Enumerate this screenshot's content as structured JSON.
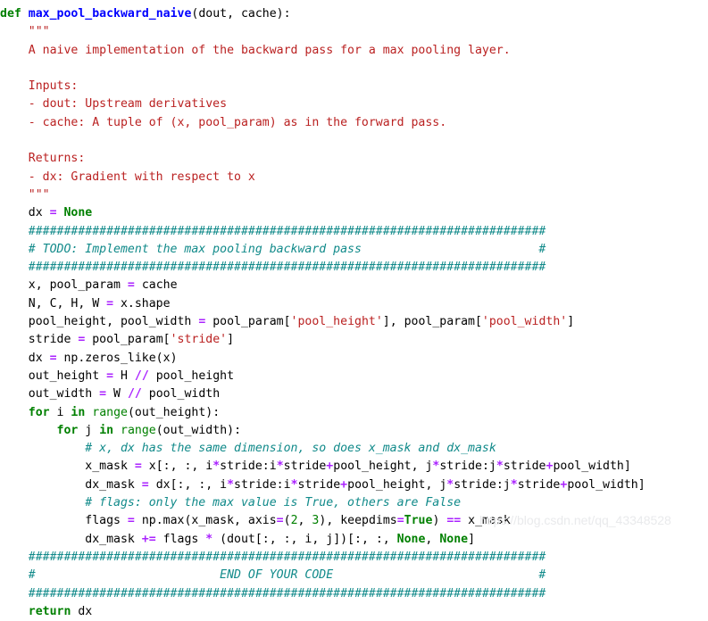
{
  "page": {
    "title": "max_pool_backward_naive",
    "language": "python",
    "background_color": "#ffffff",
    "default_text_color": "#000000"
  },
  "theme": {
    "keyword_color": "#008000",
    "function_name_color": "#0000FF",
    "string_color": "#BA2121",
    "comment_color": "#118A8A",
    "operator_color": "#AA22FF",
    "number_color": "#008000",
    "builtin_color": "#008000",
    "watermark_color": "#e9eaec"
  },
  "watermark": {
    "text": "https://blog.csdn.net/qq_43348528"
  },
  "code": {
    "lines": [
      [
        {
          "t": "def",
          "c": "kw"
        },
        {
          "t": " ",
          "c": "plain"
        },
        {
          "t": "max_pool_backward_naive",
          "c": "fname"
        },
        {
          "t": "(dout, cache):",
          "c": "plain"
        }
      ],
      [
        {
          "t": "    \"\"\"",
          "c": "doc"
        }
      ],
      [
        {
          "t": "    A naive implementation of the backward pass for a max pooling layer.",
          "c": "doc"
        }
      ],
      [
        {
          "t": "",
          "c": "plain"
        }
      ],
      [
        {
          "t": "    Inputs:",
          "c": "doc"
        }
      ],
      [
        {
          "t": "    - dout: Upstream derivatives",
          "c": "doc"
        }
      ],
      [
        {
          "t": "    - cache: A tuple of (x, pool_param) as in the forward pass.",
          "c": "doc"
        }
      ],
      [
        {
          "t": "",
          "c": "plain"
        }
      ],
      [
        {
          "t": "    Returns:",
          "c": "doc"
        }
      ],
      [
        {
          "t": "    - dx: Gradient with respect to x",
          "c": "doc"
        }
      ],
      [
        {
          "t": "    \"\"\"",
          "c": "doc"
        }
      ],
      [
        {
          "t": "    dx ",
          "c": "plain"
        },
        {
          "t": "=",
          "c": "op"
        },
        {
          "t": " ",
          "c": "plain"
        },
        {
          "t": "None",
          "c": "kwc"
        }
      ],
      [
        {
          "t": "    #########################################################################",
          "c": "comment"
        }
      ],
      [
        {
          "t": "    # TODO: Implement the max pooling backward pass                         #",
          "c": "comment"
        }
      ],
      [
        {
          "t": "    #########################################################################",
          "c": "comment"
        }
      ],
      [
        {
          "t": "    x, pool_param ",
          "c": "plain"
        },
        {
          "t": "=",
          "c": "op"
        },
        {
          "t": " cache",
          "c": "plain"
        }
      ],
      [
        {
          "t": "    N, C, H, W ",
          "c": "plain"
        },
        {
          "t": "=",
          "c": "op"
        },
        {
          "t": " x.shape",
          "c": "plain"
        }
      ],
      [
        {
          "t": "    pool_height, pool_width ",
          "c": "plain"
        },
        {
          "t": "=",
          "c": "op"
        },
        {
          "t": " pool_param[",
          "c": "plain"
        },
        {
          "t": "'pool_height'",
          "c": "str"
        },
        {
          "t": "], pool_param[",
          "c": "plain"
        },
        {
          "t": "'pool_width'",
          "c": "str"
        },
        {
          "t": "]",
          "c": "plain"
        }
      ],
      [
        {
          "t": "    stride ",
          "c": "plain"
        },
        {
          "t": "=",
          "c": "op"
        },
        {
          "t": " pool_param[",
          "c": "plain"
        },
        {
          "t": "'stride'",
          "c": "str"
        },
        {
          "t": "]",
          "c": "plain"
        }
      ],
      [
        {
          "t": "    dx ",
          "c": "plain"
        },
        {
          "t": "=",
          "c": "op"
        },
        {
          "t": " np.zeros_like(x)",
          "c": "plain"
        }
      ],
      [
        {
          "t": "    out_height ",
          "c": "plain"
        },
        {
          "t": "=",
          "c": "op"
        },
        {
          "t": " H ",
          "c": "plain"
        },
        {
          "t": "//",
          "c": "op"
        },
        {
          "t": " pool_height",
          "c": "plain"
        }
      ],
      [
        {
          "t": "    out_width ",
          "c": "plain"
        },
        {
          "t": "=",
          "c": "op"
        },
        {
          "t": " W ",
          "c": "plain"
        },
        {
          "t": "//",
          "c": "op"
        },
        {
          "t": " pool_width",
          "c": "plain"
        }
      ],
      [
        {
          "t": "    ",
          "c": "plain"
        },
        {
          "t": "for",
          "c": "kw"
        },
        {
          "t": " i ",
          "c": "plain"
        },
        {
          "t": "in",
          "c": "kw"
        },
        {
          "t": " ",
          "c": "plain"
        },
        {
          "t": "range",
          "c": "builtin"
        },
        {
          "t": "(out_height):",
          "c": "plain"
        }
      ],
      [
        {
          "t": "        ",
          "c": "plain"
        },
        {
          "t": "for",
          "c": "kw"
        },
        {
          "t": " j ",
          "c": "plain"
        },
        {
          "t": "in",
          "c": "kw"
        },
        {
          "t": " ",
          "c": "plain"
        },
        {
          "t": "range",
          "c": "builtin"
        },
        {
          "t": "(out_width):",
          "c": "plain"
        }
      ],
      [
        {
          "t": "            # x, dx has the same dimension, so does x_mask and dx_mask",
          "c": "comment"
        }
      ],
      [
        {
          "t": "            x_mask ",
          "c": "plain"
        },
        {
          "t": "=",
          "c": "op"
        },
        {
          "t": " x[:, :, i",
          "c": "plain"
        },
        {
          "t": "*",
          "c": "op"
        },
        {
          "t": "stride:i",
          "c": "plain"
        },
        {
          "t": "*",
          "c": "op"
        },
        {
          "t": "stride",
          "c": "plain"
        },
        {
          "t": "+",
          "c": "op"
        },
        {
          "t": "pool_height, j",
          "c": "plain"
        },
        {
          "t": "*",
          "c": "op"
        },
        {
          "t": "stride:j",
          "c": "plain"
        },
        {
          "t": "*",
          "c": "op"
        },
        {
          "t": "stride",
          "c": "plain"
        },
        {
          "t": "+",
          "c": "op"
        },
        {
          "t": "pool_width]",
          "c": "plain"
        }
      ],
      [
        {
          "t": "            dx_mask ",
          "c": "plain"
        },
        {
          "t": "=",
          "c": "op"
        },
        {
          "t": " dx[:, :, i",
          "c": "plain"
        },
        {
          "t": "*",
          "c": "op"
        },
        {
          "t": "stride:i",
          "c": "plain"
        },
        {
          "t": "*",
          "c": "op"
        },
        {
          "t": "stride",
          "c": "plain"
        },
        {
          "t": "+",
          "c": "op"
        },
        {
          "t": "pool_height, j",
          "c": "plain"
        },
        {
          "t": "*",
          "c": "op"
        },
        {
          "t": "stride:j",
          "c": "plain"
        },
        {
          "t": "*",
          "c": "op"
        },
        {
          "t": "stride",
          "c": "plain"
        },
        {
          "t": "+",
          "c": "op"
        },
        {
          "t": "pool_width]",
          "c": "plain"
        }
      ],
      [
        {
          "t": "            # flags: only the max value is True, others are False",
          "c": "comment"
        }
      ],
      [
        {
          "t": "            flags ",
          "c": "plain"
        },
        {
          "t": "=",
          "c": "op"
        },
        {
          "t": " np.max(x_mask, axis",
          "c": "plain"
        },
        {
          "t": "=",
          "c": "op"
        },
        {
          "t": "(",
          "c": "plain"
        },
        {
          "t": "2",
          "c": "num"
        },
        {
          "t": ", ",
          "c": "plain"
        },
        {
          "t": "3",
          "c": "num"
        },
        {
          "t": "), keepdims",
          "c": "plain"
        },
        {
          "t": "=",
          "c": "op"
        },
        {
          "t": "True",
          "c": "kwc"
        },
        {
          "t": ") ",
          "c": "plain"
        },
        {
          "t": "==",
          "c": "op"
        },
        {
          "t": " x_mask",
          "c": "plain"
        }
      ],
      [
        {
          "t": "            dx_mask ",
          "c": "plain"
        },
        {
          "t": "+=",
          "c": "op"
        },
        {
          "t": " flags ",
          "c": "plain"
        },
        {
          "t": "*",
          "c": "op"
        },
        {
          "t": " (dout[:, :, i, j])[:, :, ",
          "c": "plain"
        },
        {
          "t": "None",
          "c": "kwc"
        },
        {
          "t": ", ",
          "c": "plain"
        },
        {
          "t": "None",
          "c": "kwc"
        },
        {
          "t": "]",
          "c": "plain"
        }
      ],
      [
        {
          "t": "    #########################################################################",
          "c": "comment"
        }
      ],
      [
        {
          "t": "    #                          END OF YOUR CODE                             #",
          "c": "comment"
        }
      ],
      [
        {
          "t": "    #########################################################################",
          "c": "comment"
        }
      ],
      [
        {
          "t": "    ",
          "c": "plain"
        },
        {
          "t": "return",
          "c": "kw"
        },
        {
          "t": " dx",
          "c": "plain"
        }
      ]
    ]
  }
}
